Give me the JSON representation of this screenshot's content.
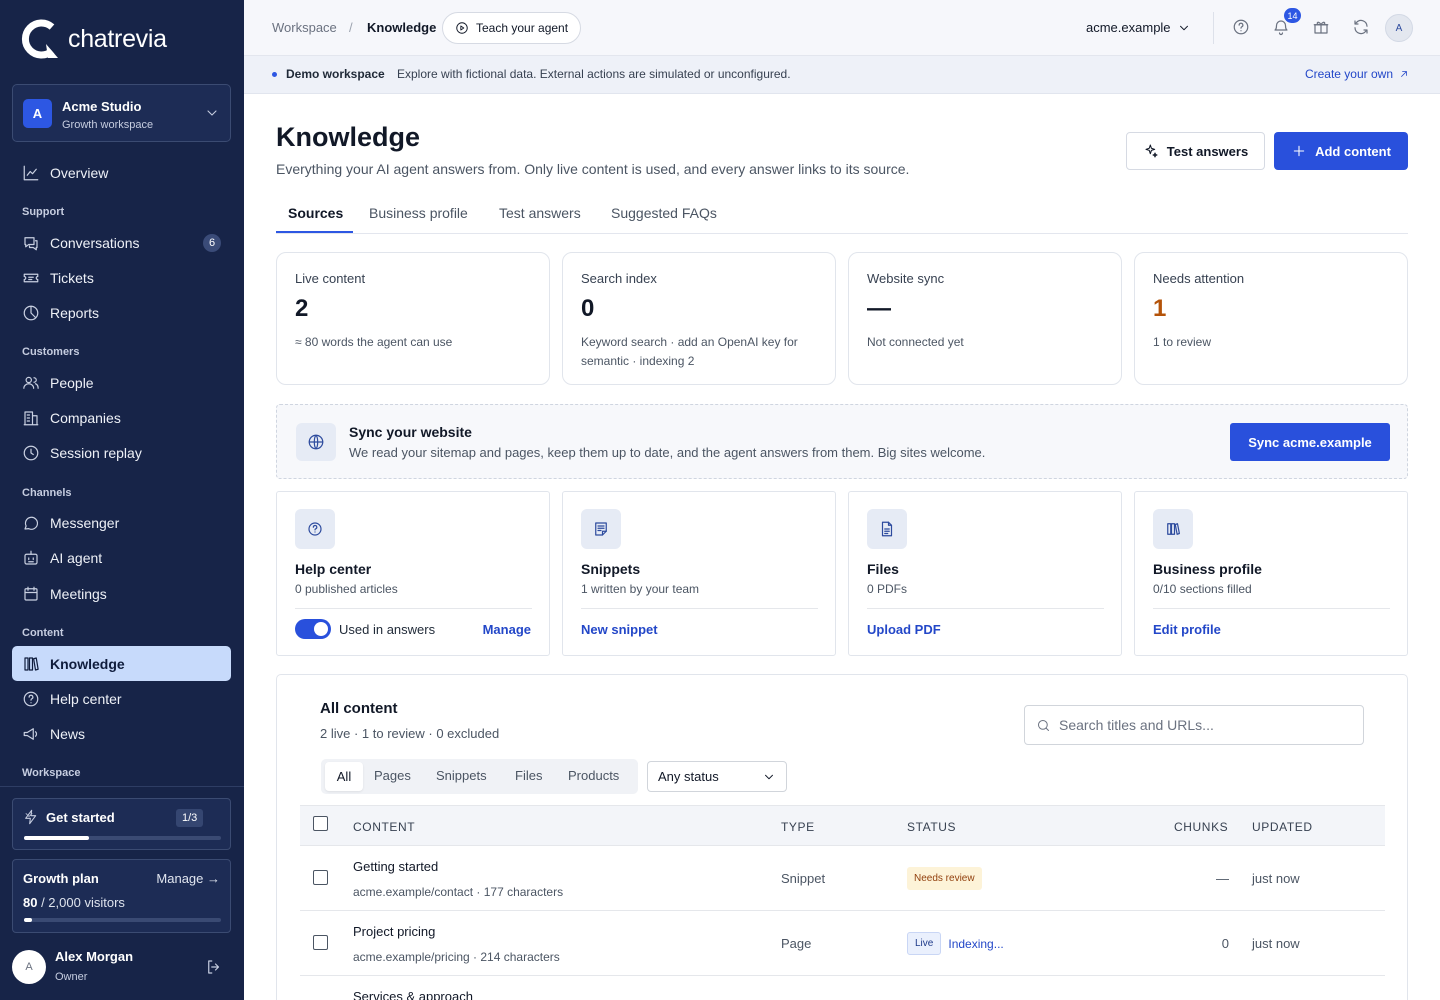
{
  "brand": {
    "name": "chatrevia"
  },
  "workspace": {
    "initial": "A",
    "name": "Acme Studio",
    "subtitle": "Growth workspace"
  },
  "nav": {
    "overview": "Overview",
    "support_section": "Support",
    "conversations": "Conversations",
    "conversations_count": "6",
    "tickets": "Tickets",
    "reports": "Reports",
    "customers_section": "Customers",
    "people": "People",
    "companies": "Companies",
    "session_replay": "Session replay",
    "channels_section": "Channels",
    "messenger": "Messenger",
    "ai_agent": "AI agent",
    "meetings": "Meetings",
    "content_section": "Content",
    "knowledge": "Knowledge",
    "help_center": "Help center",
    "news": "News",
    "workspace_section": "Workspace"
  },
  "get_started": {
    "label": "Get started",
    "count": "1/3",
    "progress": 0.33
  },
  "plan": {
    "title": "Growth plan",
    "manage": "Manage →",
    "used": "80",
    "limit_text": " / 2,000 visitors",
    "progress": 0.04
  },
  "user": {
    "initial": "A",
    "name": "Alex Morgan",
    "role": "Owner"
  },
  "topbar": {
    "crumb_workspace": "Workspace",
    "crumb_sep": "/",
    "crumb_current": "Knowledge",
    "teach_label": "Teach your agent",
    "domain": "acme.example",
    "notifications_count": "14",
    "avatar_initial": "A"
  },
  "banner": {
    "title": "Demo workspace",
    "text": "Explore with fictional data. External actions are simulated or unconfigured.",
    "link": "Create your own"
  },
  "page": {
    "title": "Knowledge",
    "description": "Everything your AI agent answers from. Only live content is used, and every answer links to its source.",
    "test_button": "Test answers",
    "add_button": "Add content"
  },
  "tabs": [
    "Sources",
    "Business profile",
    "Test answers",
    "Suggested FAQs"
  ],
  "stats": [
    {
      "label": "Live content",
      "value": "2",
      "sub": "≈ 80 words the agent can use"
    },
    {
      "label": "Search index",
      "value": "0",
      "sub": "Keyword search · add an OpenAI key for semantic · indexing 2"
    },
    {
      "label": "Website sync",
      "value": "—",
      "sub": "Not connected yet"
    },
    {
      "label": "Needs attention",
      "value": "1",
      "sub": "1 to review",
      "color": "#b45309"
    }
  ],
  "sync": {
    "title": "Sync your website",
    "desc": "We read your sitemap and pages, keep them up to date, and the agent answers from them. Big sites welcome.",
    "button": "Sync acme.example"
  },
  "sources": [
    {
      "title": "Help center",
      "sub": "0 published articles",
      "toggle_label": "Used in answers",
      "link": "Manage",
      "toggle_on": true
    },
    {
      "title": "Snippets",
      "sub": "1 written by your team",
      "link": "New snippet"
    },
    {
      "title": "Files",
      "sub": "0 PDFs",
      "link": "Upload PDF"
    },
    {
      "title": "Business profile",
      "sub": "0/10 sections filled",
      "link": "Edit profile"
    }
  ],
  "all_content": {
    "title": "All content",
    "summary": "2 live · 1 to review · 0 excluded",
    "search_placeholder": "Search titles and URLs...",
    "filters": [
      "All",
      "Pages",
      "Snippets",
      "Files",
      "Products"
    ],
    "status_filter": "Any status",
    "columns": {
      "content": "CONTENT",
      "type": "TYPE",
      "status": "STATUS",
      "chunks": "CHUNKS",
      "updated": "UPDATED"
    },
    "rows": [
      {
        "title": "Getting started",
        "sub": "acme.example/contact · 177 characters",
        "type": "Snippet",
        "status": "Needs review",
        "indexing": "",
        "chunks": "—",
        "updated": "just now"
      },
      {
        "title": "Project pricing",
        "sub": "acme.example/pricing · 214 characters",
        "type": "Page",
        "status": "Live",
        "indexing": "Indexing...",
        "chunks": "0",
        "updated": "just now"
      },
      {
        "title": "Services & approach",
        "sub": "",
        "type": "",
        "status": "",
        "indexing": "",
        "chunks": "",
        "updated": ""
      }
    ]
  },
  "colors": {
    "sidebar": "#172448",
    "accent": "#2950dc",
    "active_nav": "#c7dafb",
    "warning": "#b45309"
  }
}
